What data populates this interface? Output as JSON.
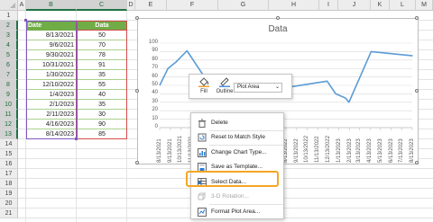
{
  "sheet": {
    "columns": [
      "A",
      "B",
      "C",
      "D",
      "E",
      "F",
      "G",
      "H",
      "I",
      "J",
      "K",
      "L",
      "M"
    ],
    "rows": [
      "1",
      "2",
      "3",
      "4",
      "5",
      "6",
      "7",
      "8",
      "9",
      "10",
      "11",
      "12",
      "13",
      "14",
      "15",
      "16",
      "17",
      "18",
      "19",
      "20",
      "21"
    ],
    "selected_columns": [
      "B",
      "C"
    ],
    "selected_rows": [
      "2",
      "3",
      "4",
      "5",
      "6",
      "7",
      "8",
      "9",
      "10",
      "11",
      "12",
      "13"
    ]
  },
  "table": {
    "header_date": "Date",
    "header_data": "Data",
    "rows": [
      {
        "date": "8/13/2021",
        "value": "50"
      },
      {
        "date": "9/6/2021",
        "value": "70"
      },
      {
        "date": "9/30/2021",
        "value": "78"
      },
      {
        "date": "10/31/2021",
        "value": "91"
      },
      {
        "date": "1/30/2022",
        "value": "35"
      },
      {
        "date": "12/10/2022",
        "value": "55"
      },
      {
        "date": "1/4/2023",
        "value": "40"
      },
      {
        "date": "2/1/2023",
        "value": "35"
      },
      {
        "date": "2/11/2023",
        "value": "30"
      },
      {
        "date": "4/16/2023",
        "value": "90"
      },
      {
        "date": "8/14/2023",
        "value": "85"
      }
    ]
  },
  "chart": {
    "title": "Data",
    "line_color": "#5b9bd5"
  },
  "chart_data": {
    "type": "line",
    "title": "Data",
    "x_tick_labels": [
      "8/13/2021",
      "9/13/2021",
      "10/13/2021",
      "11/13/2021",
      "12/13/2021",
      "1/13/2022",
      "2/13/2022",
      "3/13/2022",
      "4/13/2022",
      "5/13/2022",
      "6/13/2022",
      "7/13/2022",
      "8/13/2022",
      "9/13/2022",
      "10/13/2022",
      "11/13/2022",
      "12/13/2022",
      "1/13/2023",
      "2/13/2023",
      "3/13/2023",
      "4/13/2023",
      "5/13/2023",
      "6/13/2023",
      "7/13/2023",
      "8/13/2023"
    ],
    "ylim": [
      0,
      100
    ],
    "y_ticks": [
      "0",
      "10",
      "20",
      "30",
      "40",
      "50",
      "60",
      "70",
      "80",
      "90",
      "100"
    ],
    "grid": true,
    "series": [
      {
        "x": [
          "2021-08-13",
          "2021-09-06",
          "2021-09-30",
          "2021-10-31",
          "2022-01-30",
          "2022-12-10",
          "2023-01-04",
          "2023-02-01",
          "2023-02-11",
          "2023-04-16",
          "2023-08-14"
        ],
        "y": [
          50,
          70,
          78,
          91,
          35,
          55,
          40,
          35,
          30,
          90,
          85
        ]
      }
    ]
  },
  "mini_toolbar": {
    "fill_label": "Fill",
    "outline_label": "Outline",
    "element_select": "Plot Area",
    "fill_color": "#f0a030",
    "outline_color": "#4a90d9"
  },
  "context_menu": {
    "items": [
      {
        "label": "Delete",
        "icon": "delete-icon",
        "enabled": true
      },
      {
        "label": "Reset to Match Style",
        "icon": "reset-style-icon",
        "enabled": true
      },
      {
        "label": "Change Chart Type...",
        "icon": "change-chart-type-icon",
        "enabled": true
      },
      {
        "label": "Save as Template...",
        "icon": "save-template-icon",
        "enabled": true
      },
      {
        "label": "Select Data...",
        "icon": "select-data-icon",
        "enabled": true,
        "highlighted": true
      },
      {
        "label": "3-D Rotation...",
        "icon": "3d-rotation-icon",
        "enabled": false
      },
      {
        "label": "Format Plot Area...",
        "icon": "format-plot-area-icon",
        "enabled": true
      }
    ],
    "highlight_color": "#f5a623"
  }
}
